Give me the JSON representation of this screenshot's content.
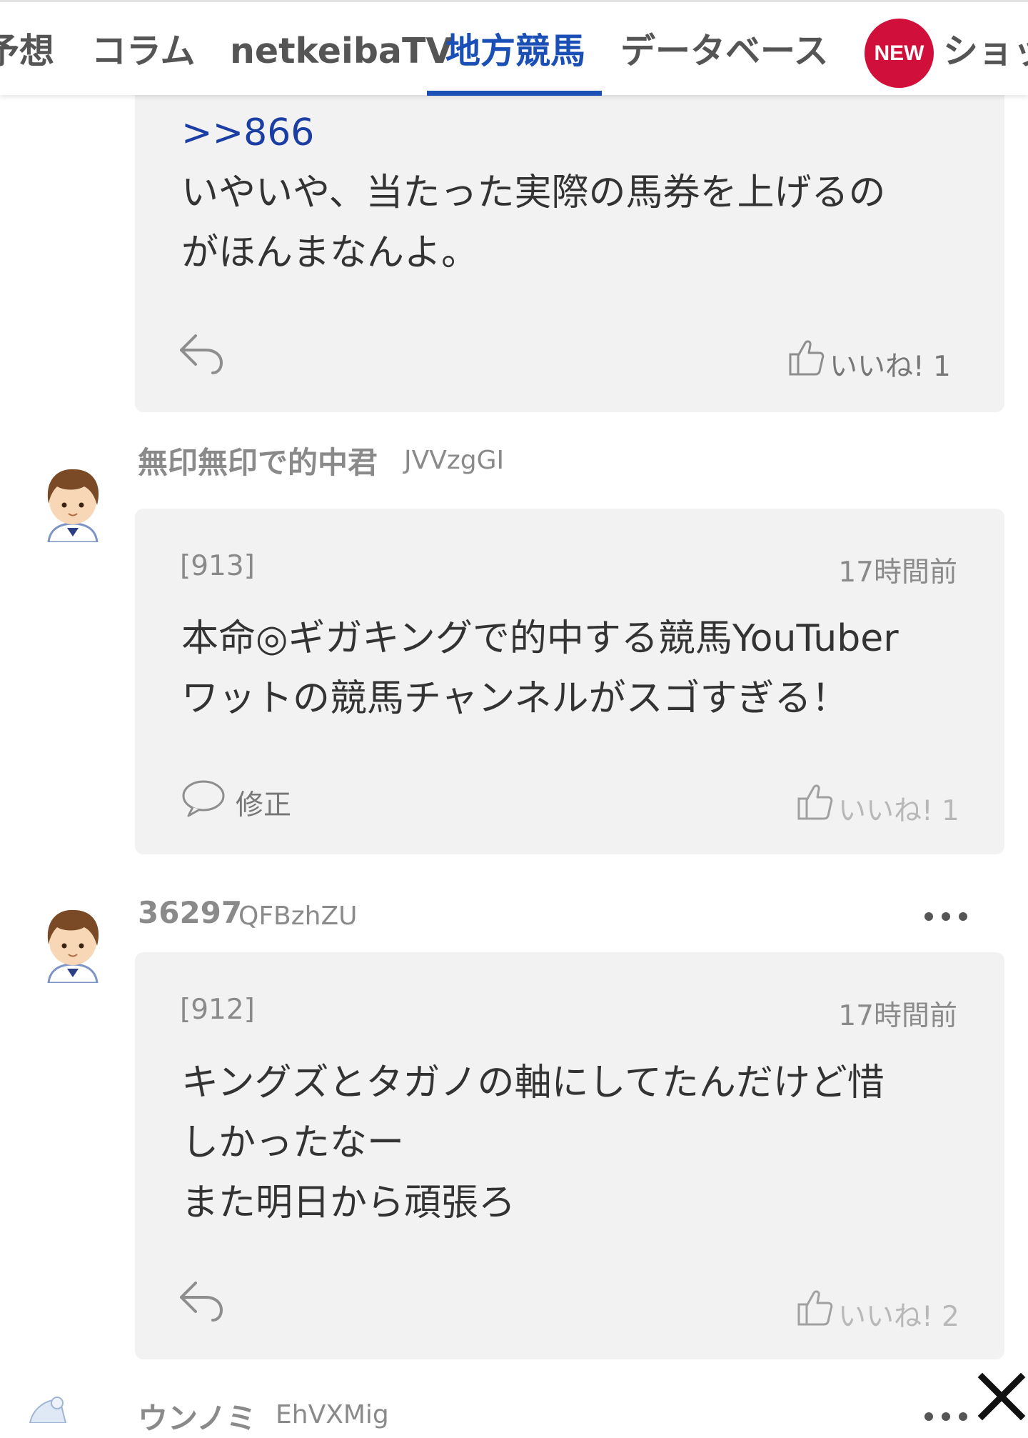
{
  "nav": {
    "tabs": [
      "予想",
      "コラム",
      "netkeibaTV",
      "地方競馬",
      "データベース",
      "ショッ"
    ],
    "active_index": 3,
    "new_badge": "NEW"
  },
  "posts": [
    {
      "quote": ">>866",
      "lines": [
        "いやいや、当たった実際の馬券を上げるの",
        "がほんまなんよ。"
      ],
      "like_label": "いいね! 1"
    },
    {
      "author": "無印無印で的中君",
      "author_id": "JVVzgGI",
      "number": "[913]",
      "time": "17時間前",
      "lines": [
        "本命◎ギガキングで的中する競馬YouTuber",
        "ワットの競馬チャンネルがスゴすぎる！"
      ],
      "edit_label": "修正",
      "like_label": "いいね! 1"
    },
    {
      "author": "36297",
      "author_id": "QFBzhZU",
      "number": "[912]",
      "time": "17時間前",
      "lines": [
        "キングズとタガノの軸にしてたんだけど惜",
        "しかったなー",
        "また明日から頑張ろ"
      ],
      "like_label": "いいね! 2"
    },
    {
      "author": "ウンノミ",
      "author_id": "EhVXMig"
    }
  ],
  "colors": {
    "accent": "#1a4fb5",
    "badge": "#d0103a",
    "card_bg": "#f2f2f2"
  }
}
